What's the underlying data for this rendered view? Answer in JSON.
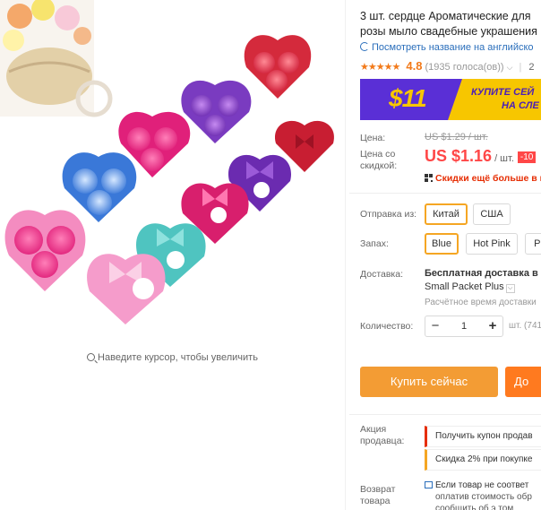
{
  "gallery": {
    "zoom_hint": "Наведите курсор, чтобы увеличить"
  },
  "product": {
    "title_line1": "3 шт. сердце Ароматические для",
    "title_line2": "розы мыло свадебные украшения",
    "translate_link": "Посмотреть название на английско",
    "rating_stars": "★★★★★",
    "rating_value": "4.8",
    "rating_count": "(1935 голоса(ов))",
    "rating_chevron": "⌵",
    "orders_prefix": "2"
  },
  "banner": {
    "big": "$11",
    "line1": "КУПИТЕ СЕЙ",
    "line2": "НА СЛЕ"
  },
  "price": {
    "label": "Цена:",
    "old": "US $1.29 / шт.",
    "discount_label_1": "Цена со",
    "discount_label_2": "скидкой:",
    "new": "US $1.16",
    "unit": "/ шт.",
    "discount_badge": "-10",
    "qr_text": "Скидки ещё больше в п"
  },
  "options": {
    "ship_from_label": "Отправка из:",
    "ship_from": [
      {
        "label": "Китай",
        "selected": true
      },
      {
        "label": "США",
        "selected": false
      }
    ],
    "scent_label": "Запах:",
    "scent": [
      {
        "label": "Blue",
        "selected": true
      },
      {
        "label": "Hot Pink",
        "selected": false
      },
      {
        "label": "Pi",
        "selected": false
      }
    ]
  },
  "shipping": {
    "label": "Доставка:",
    "title": "Бесплатная доставка в R",
    "method": "Small Packet Plus",
    "method_dropdown": "⌵",
    "time": "Расчётное время доставки"
  },
  "quantity": {
    "label": "Количество:",
    "minus": "−",
    "value": "1",
    "plus": "+",
    "unit": "шт. (741"
  },
  "actions": {
    "buy_now": "Купить сейчас",
    "add_to_cart": "До"
  },
  "seller_promo": {
    "label_1": "Акция",
    "label_2": "продавца:",
    "coupon": "Получить купон продав",
    "discount": "Скидка 2% при покупке"
  },
  "returns": {
    "label_1": "Возврат",
    "label_2": "товара",
    "line1": "Если товар не соответ",
    "line2": "оплатив стоимость обр",
    "line3": "сообщить об э том"
  },
  "colors": {
    "accent_orange": "#f39c34",
    "price_red": "#ff4747",
    "banner_purple": "#5a2fd6",
    "banner_yellow": "#f7c600",
    "link_blue": "#2a6ebb"
  }
}
